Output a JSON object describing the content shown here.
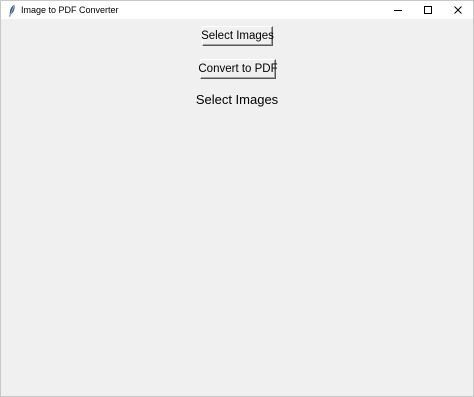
{
  "window": {
    "title": "Image to PDF Converter",
    "icon": "feather-icon",
    "controls": [
      "minimize-icon",
      "maximize-icon",
      "close-icon"
    ]
  },
  "main": {
    "select_button_label": "Select Images",
    "convert_button_label": "Convert to PDF",
    "status_label": "Select Images"
  },
  "colors": {
    "client_background": "#f0f0f0",
    "titlebar_background": "#ffffff"
  }
}
